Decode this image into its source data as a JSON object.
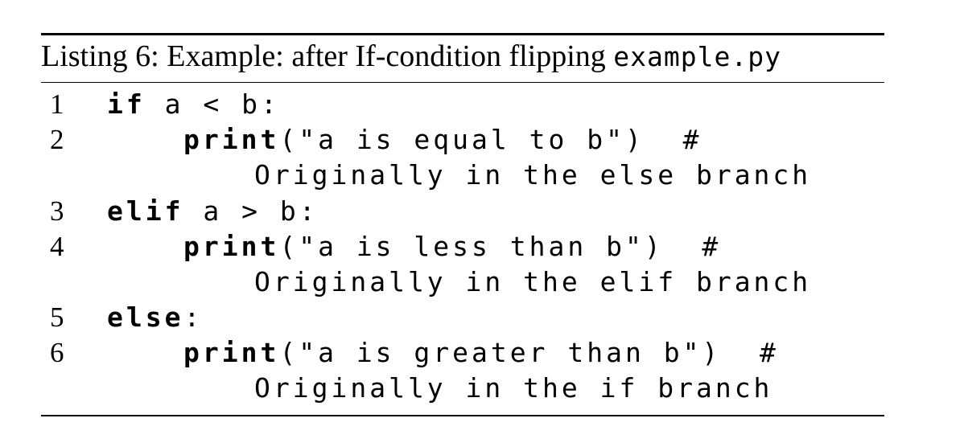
{
  "caption": {
    "label": "Listing 6: Example: after If-condition flipping",
    "filename": "example.py"
  },
  "lines": [
    {
      "num": "1",
      "kw": "if",
      "rest": " a < b:"
    },
    {
      "num": "2",
      "kw": "print",
      "rest": "(\"a is equal to b\")  #",
      "cont": "Originally in the else branch"
    },
    {
      "num": "3",
      "kw": "elif",
      "rest": " a > b:"
    },
    {
      "num": "4",
      "kw": "print",
      "rest": "(\"a is less than b\")  #",
      "cont": "Originally in the elif branch"
    },
    {
      "num": "5",
      "kw": "else",
      "rest": ":"
    },
    {
      "num": "6",
      "kw": "print",
      "rest": "(\"a is greater than b\")  #",
      "cont": "Originally in the if branch"
    }
  ]
}
